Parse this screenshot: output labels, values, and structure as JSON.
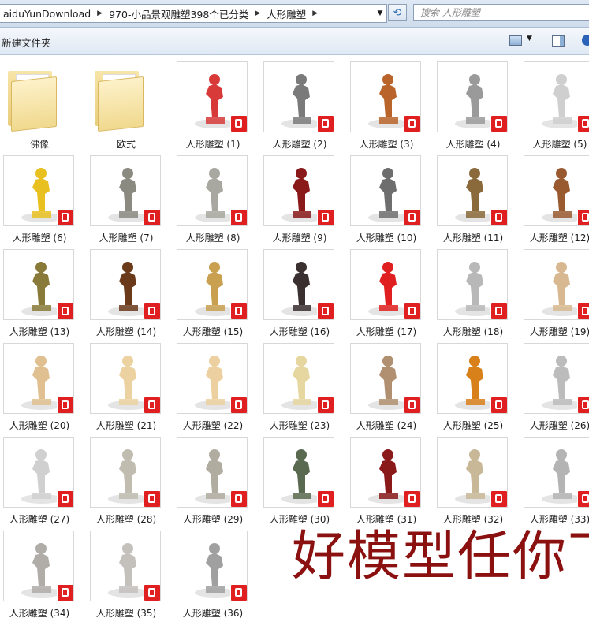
{
  "address": {
    "crumbs": [
      "aiduYunDownload",
      "970-小品景观雕塑398个已分类",
      "人形雕塑"
    ],
    "search_placeholder": "搜索 人形雕塑"
  },
  "toolbar": {
    "new_folder": "新建文件夹"
  },
  "items": [
    {
      "label": "佛像",
      "kind": "folder"
    },
    {
      "label": "欧式",
      "kind": "folder"
    },
    {
      "label": "人形雕塑 (1)",
      "kind": "skp",
      "color": "#d83a3a"
    },
    {
      "label": "人形雕塑 (2)",
      "kind": "skp",
      "color": "#7a7a7a"
    },
    {
      "label": "人形雕塑 (3)",
      "kind": "skp",
      "color": "#b8642a"
    },
    {
      "label": "人形雕塑 (4)",
      "kind": "skp",
      "color": "#9a9a9a"
    },
    {
      "label": "人形雕塑 (5)",
      "kind": "skp",
      "color": "#cfcfcf"
    },
    {
      "label": "人形雕塑 (6)",
      "kind": "skp",
      "color": "#e8c020"
    },
    {
      "label": "人形雕塑 (7)",
      "kind": "skp",
      "color": "#8a8a80"
    },
    {
      "label": "人形雕塑 (8)",
      "kind": "skp",
      "color": "#a8a8a0"
    },
    {
      "label": "人形雕塑 (9)",
      "kind": "skp",
      "color": "#8a1a1a"
    },
    {
      "label": "人形雕塑 (10)",
      "kind": "skp",
      "color": "#6e6e6e"
    },
    {
      "label": "人形雕塑 (11)",
      "kind": "skp",
      "color": "#8a6a3a"
    },
    {
      "label": "人形雕塑 (12)",
      "kind": "skp",
      "color": "#9a5a30"
    },
    {
      "label": "人形雕塑 (13)",
      "kind": "skp",
      "color": "#8a7a3a"
    },
    {
      "label": "人形雕塑 (14)",
      "kind": "skp",
      "color": "#6a3a1a"
    },
    {
      "label": "人形雕塑 (15)",
      "kind": "skp",
      "color": "#c8a050"
    },
    {
      "label": "人形雕塑 (16)",
      "kind": "skp",
      "color": "#3a3030"
    },
    {
      "label": "人形雕塑 (17)",
      "kind": "skp",
      "color": "#e02020"
    },
    {
      "label": "人形雕塑 (18)",
      "kind": "skp",
      "color": "#b8b8b8"
    },
    {
      "label": "人形雕塑 (19)",
      "kind": "skp",
      "color": "#d8b890"
    },
    {
      "label": "人形雕塑 (20)",
      "kind": "skp",
      "color": "#e0c090"
    },
    {
      "label": "人形雕塑 (21)",
      "kind": "skp",
      "color": "#ecd2a0"
    },
    {
      "label": "人形雕塑 (22)",
      "kind": "skp",
      "color": "#ecd0a0"
    },
    {
      "label": "人形雕塑 (23)",
      "kind": "skp",
      "color": "#e6d6a0"
    },
    {
      "label": "人形雕塑 (24)",
      "kind": "skp",
      "color": "#b09070"
    },
    {
      "label": "人形雕塑 (25)",
      "kind": "skp",
      "color": "#d8801a"
    },
    {
      "label": "人形雕塑 (26)",
      "kind": "skp",
      "color": "#bcbcbc"
    },
    {
      "label": "人形雕塑 (27)",
      "kind": "skp",
      "color": "#d0d0d0"
    },
    {
      "label": "人形雕塑 (28)",
      "kind": "skp",
      "color": "#c0bcb0"
    },
    {
      "label": "人形雕塑 (29)",
      "kind": "skp",
      "color": "#b0aca0"
    },
    {
      "label": "人形雕塑 (30)",
      "kind": "skp",
      "color": "#5a6a50"
    },
    {
      "label": "人形雕塑 (31)",
      "kind": "skp",
      "color": "#8a1a1a"
    },
    {
      "label": "人形雕塑 (32)",
      "kind": "skp",
      "color": "#c8b898"
    },
    {
      "label": "人形雕塑 (33)",
      "kind": "skp",
      "color": "#b4b4b4"
    },
    {
      "label": "人形雕塑 (34)",
      "kind": "skp",
      "color": "#b0aca8"
    },
    {
      "label": "人形雕塑 (35)",
      "kind": "skp",
      "color": "#c4c0bc"
    },
    {
      "label": "人形雕塑 (36)",
      "kind": "skp",
      "color": "#a0a0a0"
    }
  ],
  "watermark": "好模型任你下"
}
